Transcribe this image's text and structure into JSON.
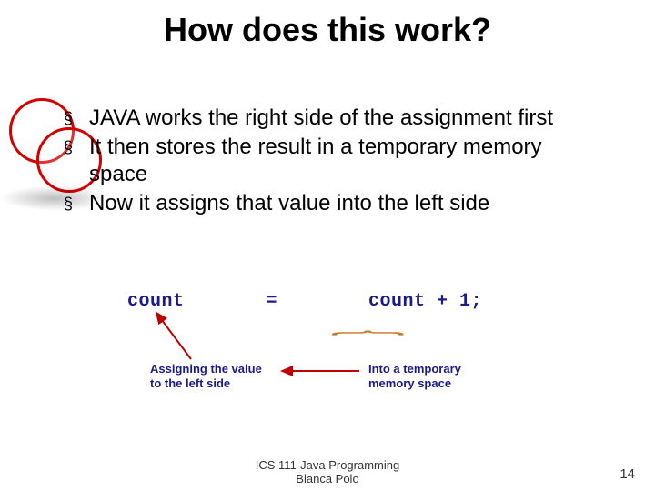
{
  "title": "How does this work?",
  "bullets": [
    "JAVA works the right side of the assignment first",
    "It then stores the result in a temporary memory space",
    "Now it assigns that value into the left side"
  ],
  "code": {
    "lhs": "count",
    "op": "=",
    "rhs": "count + 1;"
  },
  "labels": {
    "left_line1": "Assigning the value",
    "left_line2": "to the left side",
    "right_line1": "Into a temporary",
    "right_line2": "memory space"
  },
  "footer": {
    "course_line1": "ICS 111-Java Programming",
    "course_line2": "Blanca Polo",
    "page": "14"
  },
  "bullet_glyph": "§"
}
